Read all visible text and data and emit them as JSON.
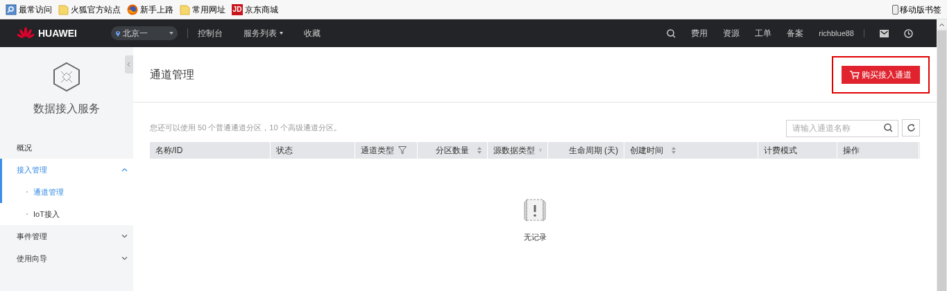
{
  "bookmarks": [
    {
      "label": "最常访问",
      "kind": "search"
    },
    {
      "label": "火狐官方站点",
      "kind": "folder"
    },
    {
      "label": "新手上路",
      "kind": "browser"
    },
    {
      "label": "常用网址",
      "kind": "folder"
    },
    {
      "label": "京东商城",
      "kind": "badge",
      "icon_text": "JD"
    }
  ],
  "mobile_bookmarks": "移动版书签",
  "header": {
    "brand": "HUAWEI",
    "region": "北京一",
    "nav": [
      {
        "label": "控制台",
        "dropdown": false
      },
      {
        "label": "服务列表",
        "dropdown": true
      },
      {
        "label": "收藏",
        "dropdown": false
      }
    ],
    "right_links": [
      "费用",
      "资源",
      "工单",
      "备案"
    ],
    "user": "richblue88"
  },
  "sidebar": {
    "service_name": "数据接入服务",
    "items": [
      {
        "label": "概况",
        "selected": false
      },
      {
        "label": "接入管理",
        "selected": true,
        "expanded": true,
        "children": [
          {
            "label": "通道管理",
            "selected": true
          },
          {
            "label": "IoT接入",
            "selected": false
          }
        ]
      },
      {
        "label": "事件管理",
        "selected": false,
        "expanded": false
      },
      {
        "label": "使用向导",
        "selected": false,
        "expanded": false
      }
    ]
  },
  "page": {
    "title": "通道管理",
    "buy_button": {
      "label": "购买接入通道",
      "highlighted": true
    },
    "quota_note": "您还可以使用 50 个普通通道分区，10 个高级通道分区。",
    "search": {
      "placeholder": "请输入通道名称"
    }
  },
  "table": {
    "columns": [
      {
        "label": "名称/ID",
        "kind": "plain"
      },
      {
        "label": "状态",
        "kind": "plain"
      },
      {
        "label": "通道类型",
        "kind": "filter"
      },
      {
        "label": "分区数量",
        "kind": "sort"
      },
      {
        "label": "源数据类型",
        "kind": "filter"
      },
      {
        "label": "生命周期 (天)",
        "kind": "plain"
      },
      {
        "label": "创建时间",
        "kind": "sort"
      },
      {
        "label": "计费模式",
        "kind": "plain"
      },
      {
        "label": "操作",
        "kind": "plain"
      }
    ],
    "empty_text": "无记录"
  }
}
